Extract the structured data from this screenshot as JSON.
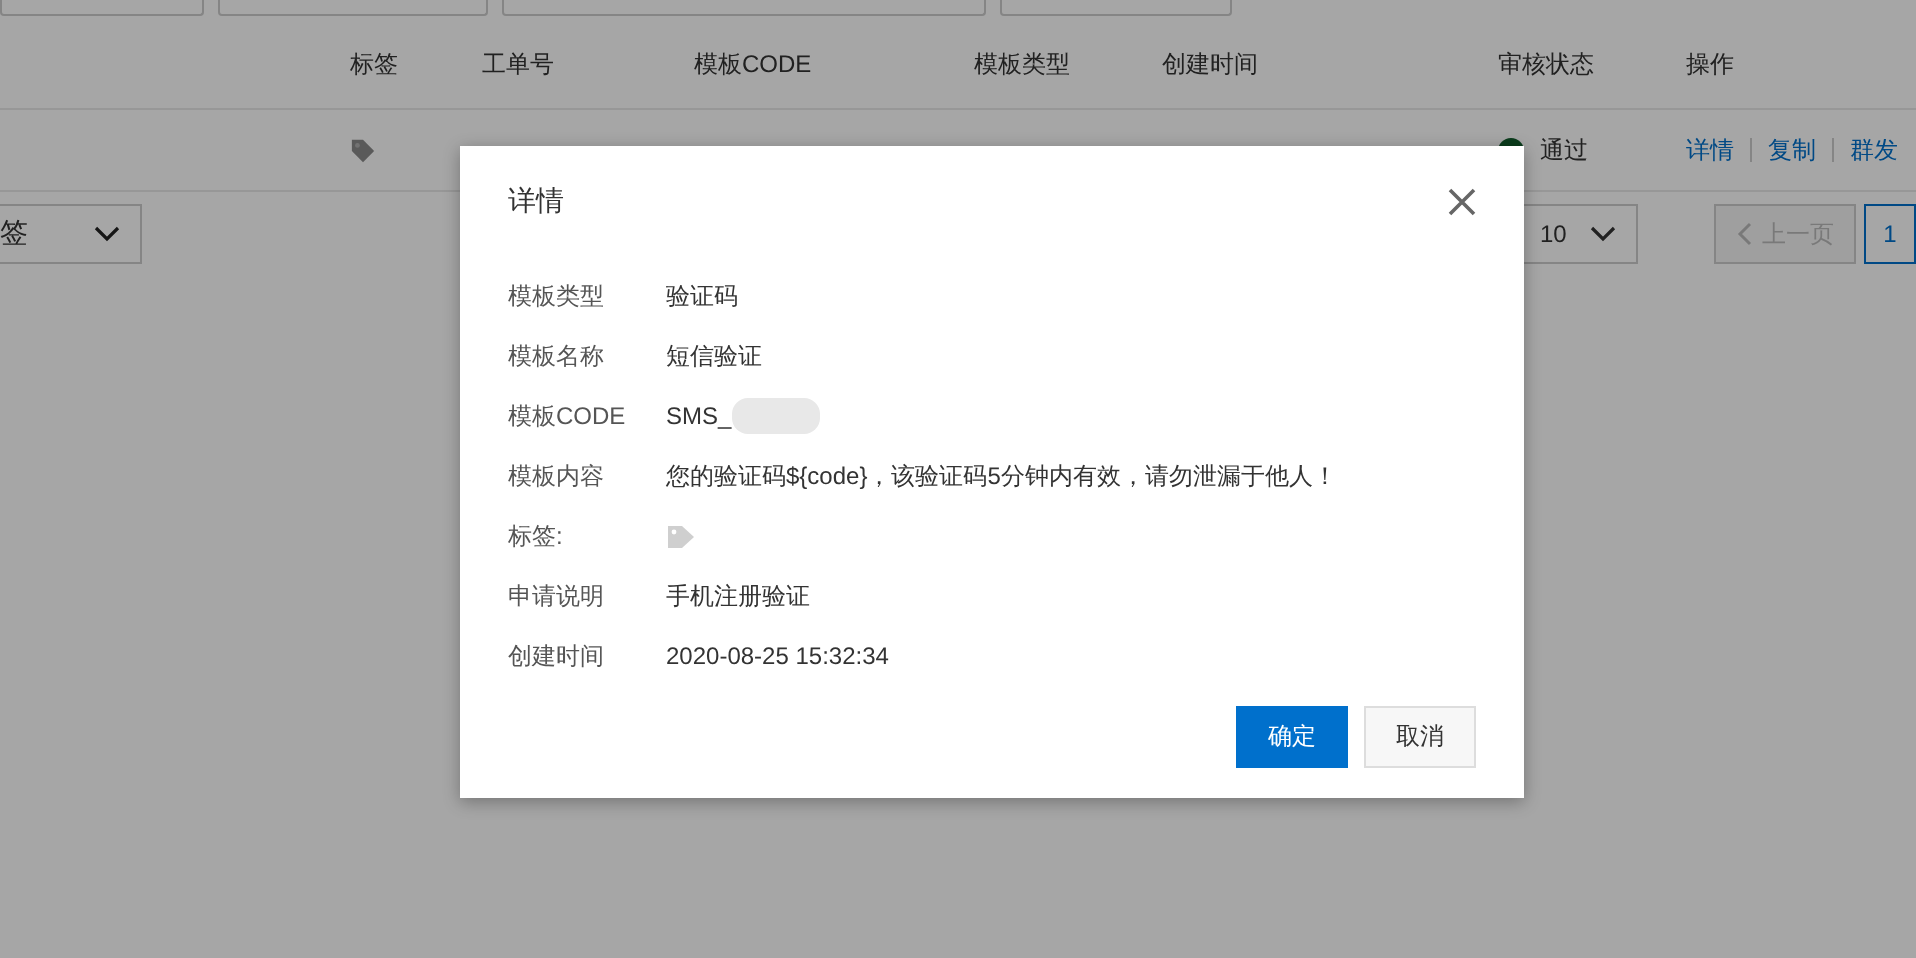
{
  "table": {
    "columns": [
      "标签",
      "工单号",
      "模板CODE",
      "模板类型",
      "创建时间",
      "审核状态",
      "操作"
    ],
    "rows": [
      {
        "status": "通过",
        "actions": [
          "详情",
          "复制",
          "群发"
        ]
      }
    ]
  },
  "tag_filter": {
    "value": "签"
  },
  "pagination": {
    "page_size": "10",
    "prev": {
      "label": "上一页",
      "disabled": true
    },
    "pages": [
      {
        "label": "1",
        "selected": true
      }
    ]
  },
  "dialog": {
    "title": "详情",
    "fields": [
      {
        "kind": "text",
        "label": "模板类型",
        "value": "验证码"
      },
      {
        "kind": "text",
        "label": "模板名称",
        "value": "短信验证"
      },
      {
        "kind": "masked",
        "label": "模板CODE",
        "value": "SMS_"
      },
      {
        "kind": "text",
        "label": "模板内容",
        "value": "您的验证码${code}，该验证码5分钟内有效，请勿泄漏于他人！"
      },
      {
        "kind": "tag",
        "label": "标签:"
      },
      {
        "kind": "text",
        "label": "申请说明",
        "value": "手机注册验证"
      },
      {
        "kind": "text",
        "label": "创建时间",
        "value": "2020-08-25 15:32:34"
      }
    ],
    "buttons": [
      {
        "label": "确定",
        "primary": true
      },
      {
        "label": "取消",
        "primary": false
      }
    ]
  }
}
